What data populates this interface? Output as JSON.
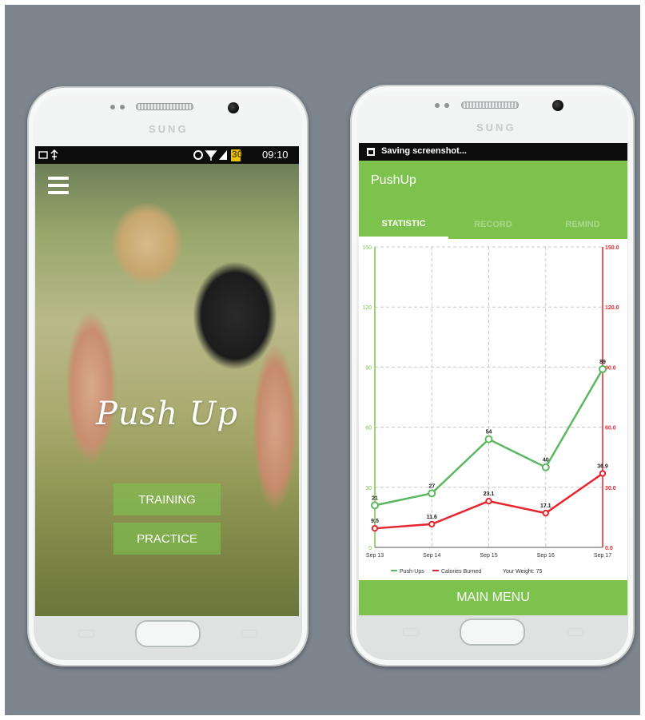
{
  "phone_left": {
    "brand": "SUNG",
    "status": {
      "time": "09:10",
      "battery": "30"
    },
    "hero": {
      "title": "Push Up",
      "buttons": {
        "training": "TRAINING",
        "practice": "PRACTICE"
      }
    }
  },
  "phone_right": {
    "brand": "SUNG",
    "status": {
      "notification": "Saving screenshot..."
    },
    "app_title": "PushUp",
    "tabs": [
      {
        "label": "STATISTIC",
        "active": true
      },
      {
        "label": "RECORD",
        "active": false
      },
      {
        "label": "REMIND",
        "active": false
      }
    ],
    "main_menu": "MAIN MENU"
  },
  "colors": {
    "accent": "#7cc24d",
    "backdrop": "#7d858e",
    "pushups_line": "#5cb860",
    "calories_line": "#e8242c"
  },
  "chart_data": {
    "type": "line",
    "categories": [
      "Sep 13",
      "Sep 14",
      "Sep 15",
      "Sep 16",
      "Sep 17"
    ],
    "series": [
      {
        "name": "Push-Ups",
        "axis": "left",
        "values": [
          21,
          27,
          54,
          40,
          89
        ],
        "labels": [
          "21",
          "27",
          "54",
          "40",
          "89"
        ]
      },
      {
        "name": "Calories Burned",
        "axis": "right",
        "values": [
          9.5,
          11.6,
          23.1,
          17.1,
          36.9
        ],
        "labels": [
          "9.5",
          "11.6",
          "23.1",
          "17.1",
          "36.9"
        ]
      }
    ],
    "left_axis": {
      "ylim": [
        0,
        150
      ],
      "ticks": [
        "0",
        "30",
        "60",
        "90",
        "120",
        "150"
      ]
    },
    "right_axis": {
      "ylim": [
        0,
        150
      ],
      "ticks": [
        "0.0",
        "30.0",
        "60.0",
        "90.0",
        "120.0",
        "150.0"
      ]
    },
    "legend": {
      "position": "bottom",
      "items": [
        "Push-Ups",
        "Calories Burned",
        "Your Weight: 75"
      ]
    },
    "grid": true
  }
}
